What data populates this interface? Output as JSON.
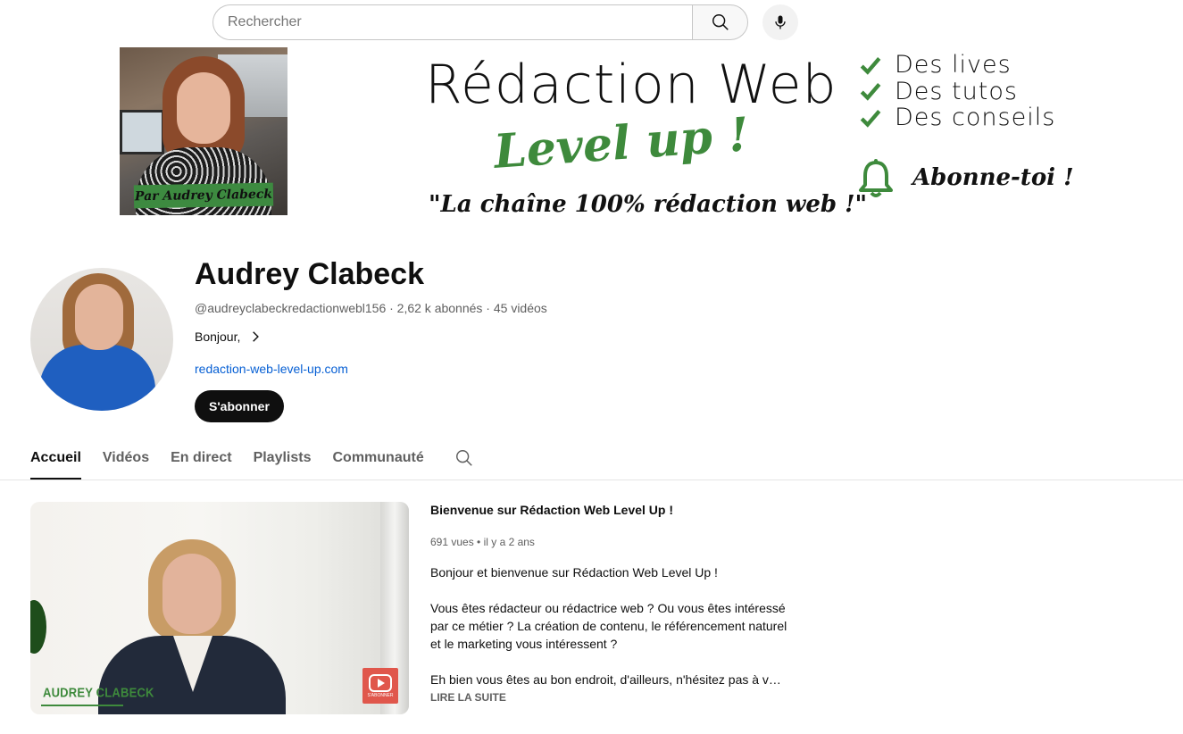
{
  "search": {
    "placeholder": "Rechercher",
    "search_icon": "search-icon",
    "mic_icon": "microphone-icon"
  },
  "banner": {
    "photo_tag": "Par Audrey Clabeck",
    "title": "Rédaction Web",
    "level_up": "Level up !",
    "tagline": "\"La chaîne 100% rédaction web !\"",
    "checklist": [
      "Des lives",
      "Des tutos",
      "Des conseils"
    ],
    "bell_icon": "bell-icon",
    "subscribe_script": "Abonne-toi !",
    "accent_color": "#3e8a3c"
  },
  "channel": {
    "name": "Audrey Clabeck",
    "meta": "@audreyclabeckredactionwebl156 · 2,62 k abonnés · 45 vidéos",
    "description": "Bonjour,",
    "link": "redaction-web-level-up.com",
    "subscribe_label": "S'abonner"
  },
  "tabs": [
    {
      "label": "Accueil",
      "active": true
    },
    {
      "label": "Vidéos",
      "active": false
    },
    {
      "label": "En direct",
      "active": false
    },
    {
      "label": "Playlists",
      "active": false
    },
    {
      "label": "Communauté",
      "active": false
    }
  ],
  "featured": {
    "thumb_name": "AUDREY CLABECK",
    "thumb_badge": "S'ABONNER",
    "title": "Bienvenue sur Rédaction Web Level Up !",
    "meta": "691 vues • il y a 2 ans",
    "description": [
      "Bonjour et bienvenue sur Rédaction Web Level Up !",
      "Vous êtes rédacteur ou rédactrice web ? Ou vous êtes intéressé par ce métier ? La création de contenu, le référencement naturel et le marketing vous intéressent ?",
      "Eh bien vous êtes au bon endroit, d'ailleurs, n'hésitez pas à vou..."
    ],
    "read_more": "LIRE LA SUITE"
  }
}
